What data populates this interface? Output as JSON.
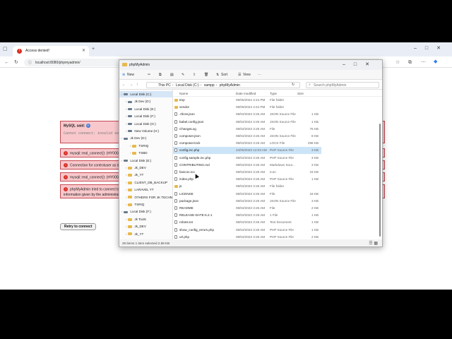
{
  "browser": {
    "tab_title": "Access denied!",
    "url": "localhost:8080/phpmyadmin/"
  },
  "pma": {
    "sql_title": "MySQL said:",
    "sql_code": "Cannot connect: invalid setti",
    "errors": [
      "mysqli::real_connect(): (HY000/2",
      "Connection for controluser as de",
      "mysqli::real_connect(): (HY000/2",
      "phpMyAdmin tried to connect to t",
      "information given by the administrato"
    ],
    "retry_label": "Retry to connect"
  },
  "explorer": {
    "title": "phpMyAdmin",
    "cmd": {
      "new": "New",
      "sort": "Sort",
      "view": "View"
    },
    "breadcrumb": [
      "This PC",
      "Local Disk (C:)",
      "xampp",
      "phpMyAdmin"
    ],
    "search_placeholder": "Search phpMyAdmin",
    "columns": {
      "name": "Name",
      "date": "Date modified",
      "type": "Type",
      "size": "Size"
    },
    "nav": [
      {
        "label": "Local Disk (C:)",
        "kind": "drive",
        "indent": 0,
        "selected": true
      },
      {
        "label": "Jk Dev (D:)",
        "kind": "drive",
        "indent": 1
      },
      {
        "label": "Local Disk (E:)",
        "kind": "drive",
        "indent": 1
      },
      {
        "label": "Local Disk (F:)",
        "kind": "drive",
        "indent": 1
      },
      {
        "label": "Local Disk (G:)",
        "kind": "drive",
        "indent": 1
      },
      {
        "label": "New Volume (H:)",
        "kind": "drive",
        "indent": 1
      },
      {
        "label": "Jk Dev (D:)",
        "kind": "drive",
        "indent": 0
      },
      {
        "label": "TSRIQ",
        "kind": "folder",
        "indent": 2
      },
      {
        "label": "TSBD",
        "kind": "folder",
        "indent": 2
      },
      {
        "label": "Local Disk (E:)",
        "kind": "drive",
        "indent": 0
      },
      {
        "label": "Jk_DEV",
        "kind": "folder",
        "indent": 1
      },
      {
        "label": "Jk_YT",
        "kind": "folder",
        "indent": 1
      },
      {
        "label": "CLIENT_DB_BACKUP",
        "kind": "folder",
        "indent": 1
      },
      {
        "label": "LARAVEL YT",
        "kind": "folder",
        "indent": 1
      },
      {
        "label": "OTHERS FOR JK TECHNO",
        "kind": "folder",
        "indent": 1
      },
      {
        "label": "TSRIQ",
        "kind": "folder",
        "indent": 1
      },
      {
        "label": "Local Disk (F:)",
        "kind": "drive",
        "indent": 0
      },
      {
        "label": "Jk Tools",
        "kind": "folder",
        "indent": 1
      },
      {
        "label": "Jk_DEV",
        "kind": "folder",
        "indent": 1
      },
      {
        "label": "Jk_YT",
        "kind": "folder",
        "indent": 1
      }
    ],
    "files": [
      {
        "name": "tmp",
        "date": "09/06/2024 4:44 PM",
        "type": "File folder",
        "size": "",
        "kind": "folder"
      },
      {
        "name": "vendor",
        "date": "09/06/2024 4:44 PM",
        "type": "File folder",
        "size": "",
        "kind": "folder"
      },
      {
        "name": ".rtlcss.json",
        "date": "08/02/2023 3:26 AM",
        "type": "JSON Source File",
        "size": "1 KB",
        "kind": "file"
      },
      {
        "name": "babel.config.json",
        "date": "08/02/2023 3:26 AM",
        "type": "JSON Source File",
        "size": "1 KB",
        "kind": "file"
      },
      {
        "name": "ChangeLog",
        "date": "08/02/2023 3:26 AM",
        "type": "File",
        "size": "76 KB",
        "kind": "file"
      },
      {
        "name": "composer.json",
        "date": "08/02/2023 3:26 AM",
        "type": "JSON Source File",
        "size": "8 KB",
        "kind": "file"
      },
      {
        "name": "composer.lock",
        "date": "08/02/2023 3:26 AM",
        "type": "LOCK File",
        "size": "296 KB",
        "kind": "file"
      },
      {
        "name": "config.inc.php",
        "date": "24/06/2023 12:03 AM",
        "type": "PHP Source File",
        "size": "3 KB",
        "kind": "file",
        "selected": true
      },
      {
        "name": "config.sample.inc.php",
        "date": "08/02/2023 3:26 AM",
        "type": "PHP Source File",
        "size": "3 KB",
        "kind": "file"
      },
      {
        "name": "CONTRIBUTING.md",
        "date": "08/02/2023 3:26 AM",
        "type": "Markdown Sour...",
        "size": "3 KB",
        "kind": "file"
      },
      {
        "name": "favicon.ico",
        "date": "08/02/2023 3:26 AM",
        "type": "Icon",
        "size": "23 KB",
        "kind": "file"
      },
      {
        "name": "index.php",
        "date": "08/02/2023 3:26 AM",
        "type": "PHP Source File",
        "size": "1 KB",
        "kind": "file"
      },
      {
        "name": "js",
        "date": "08/02/2023 3:26 AM",
        "type": "File folder",
        "size": "",
        "kind": "folder"
      },
      {
        "name": "LICENSE",
        "date": "08/02/2023 3:26 AM",
        "type": "File",
        "size": "18 KB",
        "kind": "file"
      },
      {
        "name": "package.json",
        "date": "08/02/2023 3:26 AM",
        "type": "JSON Source File",
        "size": "3 KB",
        "kind": "file"
      },
      {
        "name": "README",
        "date": "08/02/2023 3:26 AM",
        "type": "File",
        "size": "2 KB",
        "kind": "file"
      },
      {
        "name": "RELEASE-DATE-5.2.1",
        "date": "08/02/2023 3:26 AM",
        "type": "1 File",
        "size": "1 KB",
        "kind": "file"
      },
      {
        "name": "robots.txt",
        "date": "08/02/2023 3:26 AM",
        "type": "Text Document",
        "size": "1 KB",
        "kind": "file"
      },
      {
        "name": "show_config_errors.php",
        "date": "08/02/2023 3:26 AM",
        "type": "PHP Source File",
        "size": "1 KB",
        "kind": "file"
      },
      {
        "name": "url.php",
        "date": "08/02/2023 3:26 AM",
        "type": "PHP Source File",
        "size": "2 KB",
        "kind": "file"
      },
      {
        "name": "yarn.lock",
        "date": "08/02/2023 3:26 AM",
        "type": "LOCK File",
        "size": "248 KB",
        "kind": "file"
      }
    ],
    "status": "29 items    1 item selected  2.88 KB"
  }
}
